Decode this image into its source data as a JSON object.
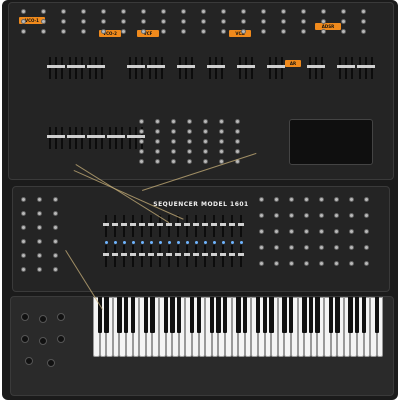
{
  "synth": {
    "top_labels": {
      "vco1": "VCO-1",
      "vco2": "VCO-2",
      "vcf": "VCF",
      "vca": "VCA",
      "ar": "AR",
      "adsr": "ADSR"
    },
    "sequencer": {
      "title": "SEQUENCER MODEL 1601"
    },
    "colors": {
      "accent": "#f08a1c",
      "panel": "#242424",
      "body": "#1b1b1b",
      "led": "#6fb4ff"
    },
    "icons": {
      "jack": "patch-jack-icon",
      "knob": "knob-icon",
      "slider": "slider-icon"
    }
  }
}
